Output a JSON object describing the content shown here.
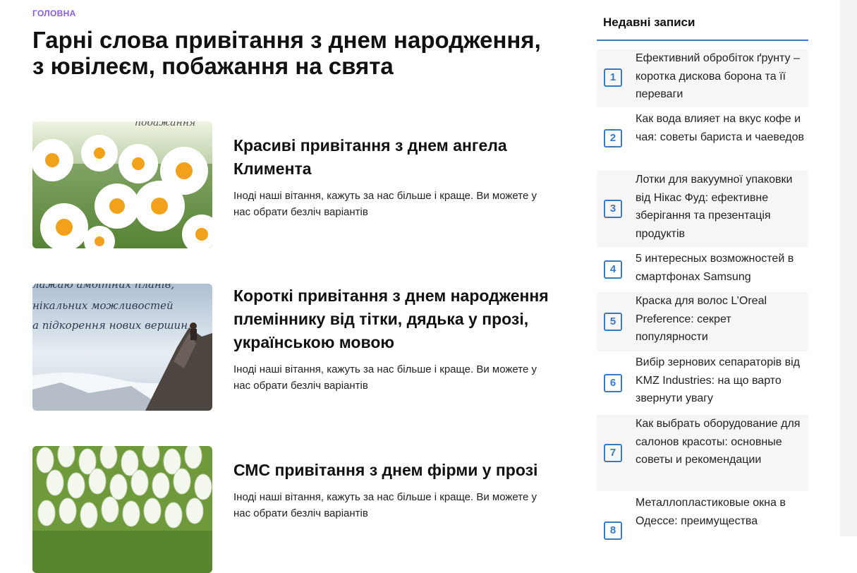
{
  "breadcrumb": {
    "label": "ГОЛОВНА"
  },
  "page": {
    "title": "Гарні слова привітання з днем народження, з ювілеєм, побажання на свята"
  },
  "posts": [
    {
      "title": "Красиві привітання з днем ангела Климента",
      "excerpt": "Іноді наші вітання, кажуть за нас більше і краще. Ви можете у нас обрати безліч варіантів",
      "thumb_caption": "побажання"
    },
    {
      "title": "Короткі привітання з днем народження племіннику від тітки, дядька у прозі, українською мовою",
      "excerpt": "Іноді наші вітання, кажуть за нас більше і краще. Ви можете у нас обрати безліч варіантів",
      "thumb_lines": [
        "лажаю амбітних планів,",
        "нікальних можливостей",
        "а підкорення нових вершин"
      ]
    },
    {
      "title": "СМС привітання з днем фірми у прозі",
      "excerpt": "Іноді наші вітання, кажуть за нас більше і краще. Ви можете у нас обрати безліч варіантів"
    }
  ],
  "sidebar": {
    "heading": "Недавні записи",
    "items": [
      {
        "num": "1",
        "text": "Ефективний обробіток ґрунту – коротка дискова борона та її переваги"
      },
      {
        "num": "2",
        "text": "Как вода влияет на вкус кофе и чая: советы бариста и чаеведов"
      },
      {
        "num": "3",
        "text": "Лотки для вакуумної упаковки від Нікас Фуд: ефективне зберігання та презентація продуктів"
      },
      {
        "num": "4",
        "text": "5 интересных возможностей в смартфонах Samsung"
      },
      {
        "num": "5",
        "text": "Краска для волос L’Oreal Preference: секрет популярности"
      },
      {
        "num": "6",
        "text": "Вибір зернових сепараторів від KMZ Industries: на що варто звернути увагу"
      },
      {
        "num": "7",
        "text": "Как выбрать оборудование для салонов красоты: основные советы и рекомендации"
      },
      {
        "num": "8",
        "text": "Металлопластиковые окна в Одессе: преимущества"
      }
    ]
  },
  "colors": {
    "accent": "#3a7ac0",
    "breadcrumb": "#8a5cd6",
    "alt_row": "#f6f6f6"
  }
}
